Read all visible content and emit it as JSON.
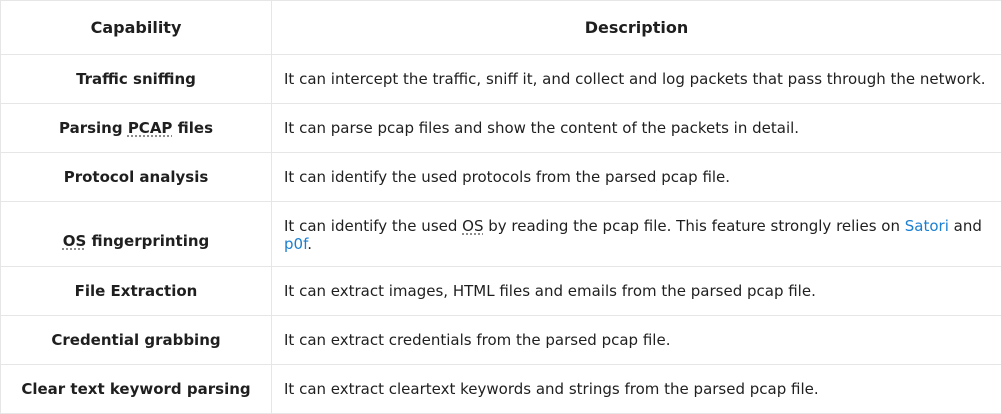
{
  "headers": {
    "capability": "Capability",
    "description": "Description"
  },
  "rows": [
    {
      "capability": "Traffic sniffing",
      "description": "It can intercept the traffic, sniff it, and collect and log packets that pass through the network."
    },
    {
      "capability_pre": "Parsing ",
      "capability_abbr": "PCAP",
      "capability_post": " files",
      "description": "It can parse pcap files and show the content of the packets in detail."
    },
    {
      "capability": "Protocol analysis",
      "description": "It can identify the used protocols from the parsed pcap file."
    },
    {
      "capability_abbr": "OS",
      "capability_post": " fingerprinting",
      "description_pre": "It can identify the used ",
      "description_abbr": "OS",
      "description_mid": " by reading the pcap file. This feature strongly relies on ",
      "link1": "Satori",
      "description_and": " and ",
      "link2": "p0f",
      "description_end": "."
    },
    {
      "capability": "File Extraction",
      "description": "It can extract images, HTML files and emails from the parsed pcap file."
    },
    {
      "capability": "Credential grabbing",
      "description": "It can extract credentials from the parsed pcap file."
    },
    {
      "capability": "Clear text keyword parsing",
      "description": "It can extract cleartext keywords and strings from the parsed pcap file."
    }
  ],
  "colors": {
    "link": "#1a7fd1",
    "border": "#e6e6e6"
  }
}
